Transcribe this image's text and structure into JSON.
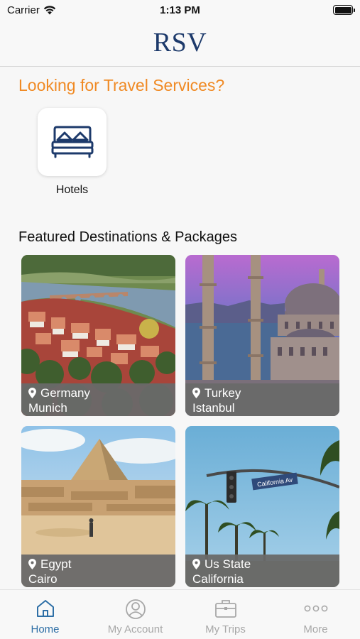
{
  "status_bar": {
    "carrier": "Carrier",
    "time": "1:13 PM"
  },
  "header": {
    "logo": "RSV"
  },
  "services": {
    "title": "Looking for Travel Services?",
    "items": [
      {
        "label": "Hotels",
        "icon": "bed-icon"
      }
    ]
  },
  "featured": {
    "title": "Featured Destinations & Packages",
    "cards": [
      {
        "country": "Germany",
        "city": "Munich"
      },
      {
        "country": "Turkey",
        "city": "Istanbul"
      },
      {
        "country": "Egypt",
        "city": "Cairo"
      },
      {
        "country": "Us State",
        "city": "California",
        "sign_text": "California Av"
      }
    ]
  },
  "tab_bar": {
    "tabs": [
      {
        "label": "Home",
        "icon": "home-icon",
        "active": true
      },
      {
        "label": "My Account",
        "icon": "user-circle-icon",
        "active": false
      },
      {
        "label": "My Trips",
        "icon": "briefcase-icon",
        "active": false
      },
      {
        "label": "More",
        "icon": "more-dots-icon",
        "active": false
      }
    ]
  },
  "colors": {
    "accent_orange": "#f08a24",
    "brand_navy": "#1d3a6b",
    "tab_active": "#2e6fa6",
    "tab_inactive": "#a8a8a8"
  }
}
